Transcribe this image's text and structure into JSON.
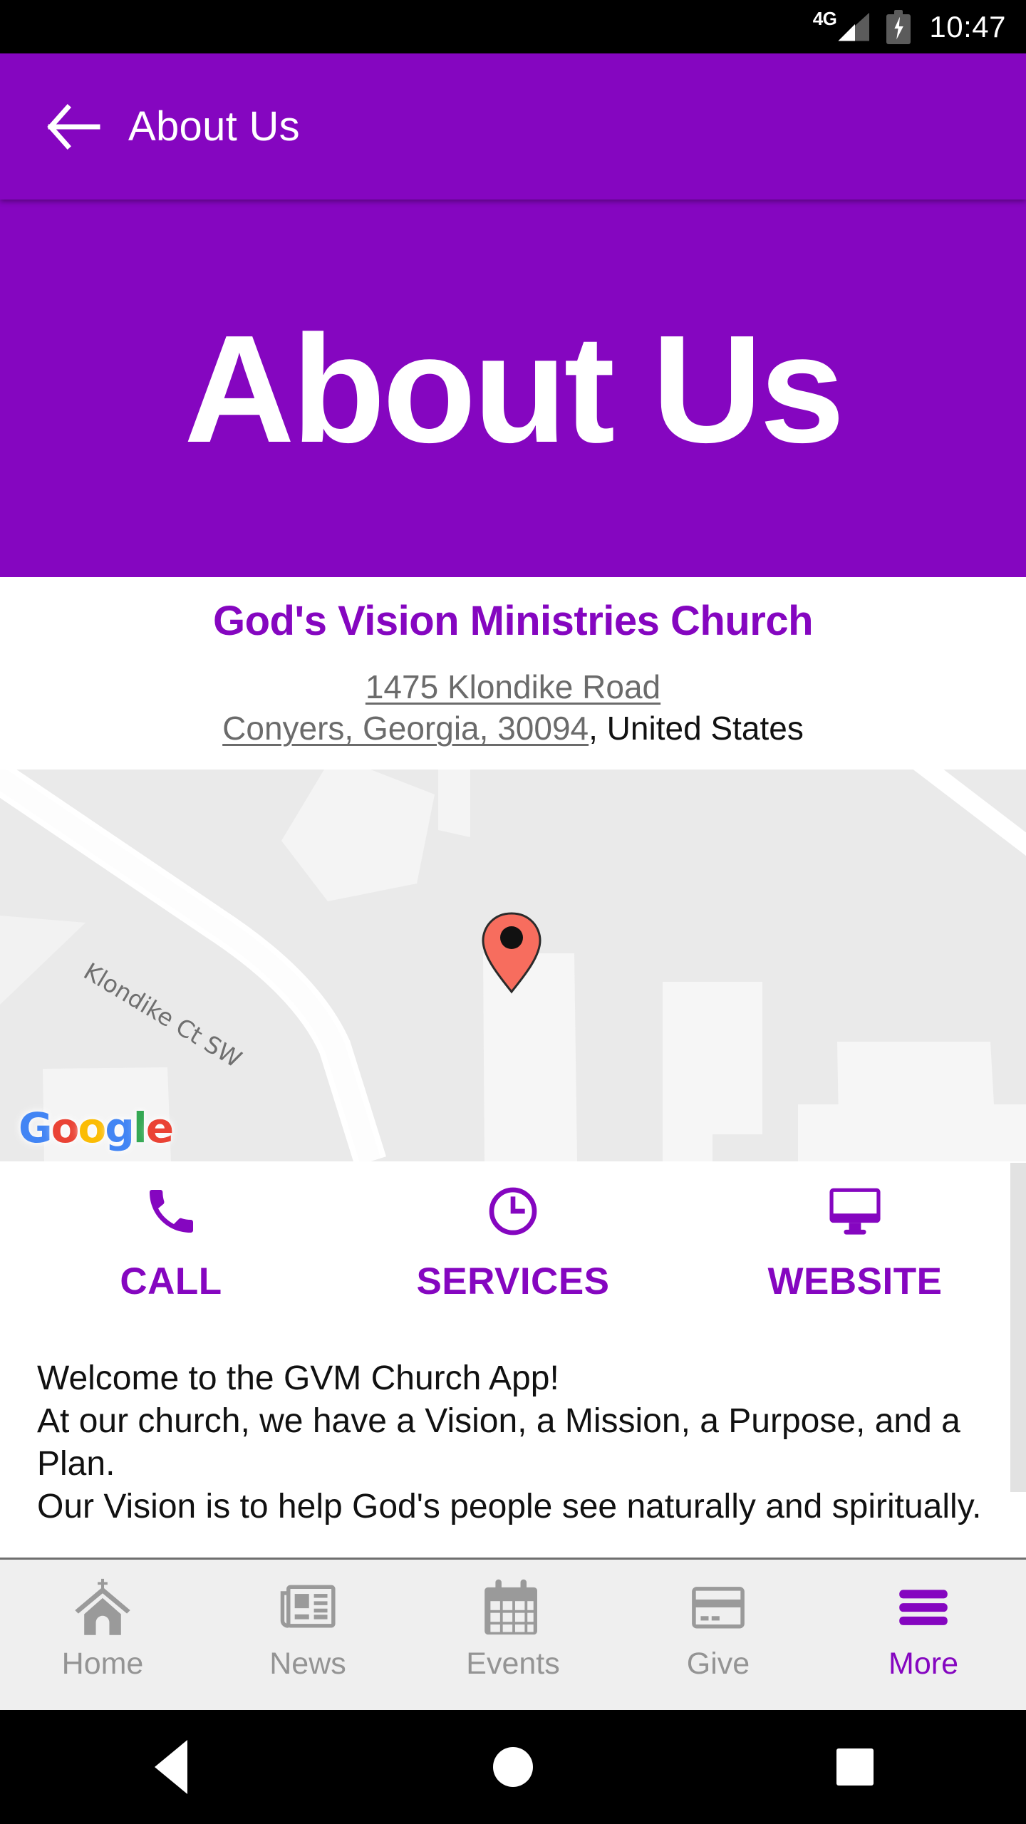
{
  "status_bar": {
    "network": "4G",
    "time": "10:47",
    "battery_state": "charging",
    "signal_icon": "signal-bars-icon",
    "battery_icon": "battery-charging-icon"
  },
  "app_bar": {
    "back_icon": "back-arrow-icon",
    "title": "About Us"
  },
  "hero": {
    "title": "About Us",
    "background_color": "#8506C0"
  },
  "church": {
    "name": "God's Vision Ministries Church",
    "address_line1": "1475 Klondike Road",
    "address_line2": "Conyers, Georgia, 30094",
    "country": ", United States"
  },
  "map": {
    "street_label": "Klondike Ct SW",
    "provider_logo": "Google",
    "logo_letters": [
      "G",
      "o",
      "o",
      "g",
      "l",
      "e"
    ],
    "pin_icon": "map-pin-icon",
    "pin_color": "#F76D5E"
  },
  "actions": [
    {
      "label": "CALL",
      "icon": "phone-icon"
    },
    {
      "label": "SERVICES",
      "icon": "clock-icon"
    },
    {
      "label": "WEBSITE",
      "icon": "monitor-icon"
    }
  ],
  "body": {
    "line1": "Welcome to the GVM Church App!",
    "line2": "At our church, we have a Vision, a Mission, a Purpose, and a Plan.",
    "line3": "Our Vision is to help God's people see naturally and spiritually."
  },
  "bottom_nav": [
    {
      "label": "Home",
      "icon": "church-icon",
      "active": false
    },
    {
      "label": "News",
      "icon": "newspaper-icon",
      "active": false
    },
    {
      "label": "Events",
      "icon": "calendar-icon",
      "active": false
    },
    {
      "label": "Give",
      "icon": "credit-card-icon",
      "active": false
    },
    {
      "label": "More",
      "icon": "hamburger-icon",
      "active": true
    }
  ],
  "system_nav": {
    "back": "system-back-icon",
    "home": "system-home-icon",
    "recents": "system-recents-icon"
  },
  "colors": {
    "brand_purple": "#8506C0",
    "link_gray": "#6b6b6b",
    "nav_inactive": "#949494",
    "nav_background": "#efefef",
    "map_background": "#eaeaea"
  }
}
